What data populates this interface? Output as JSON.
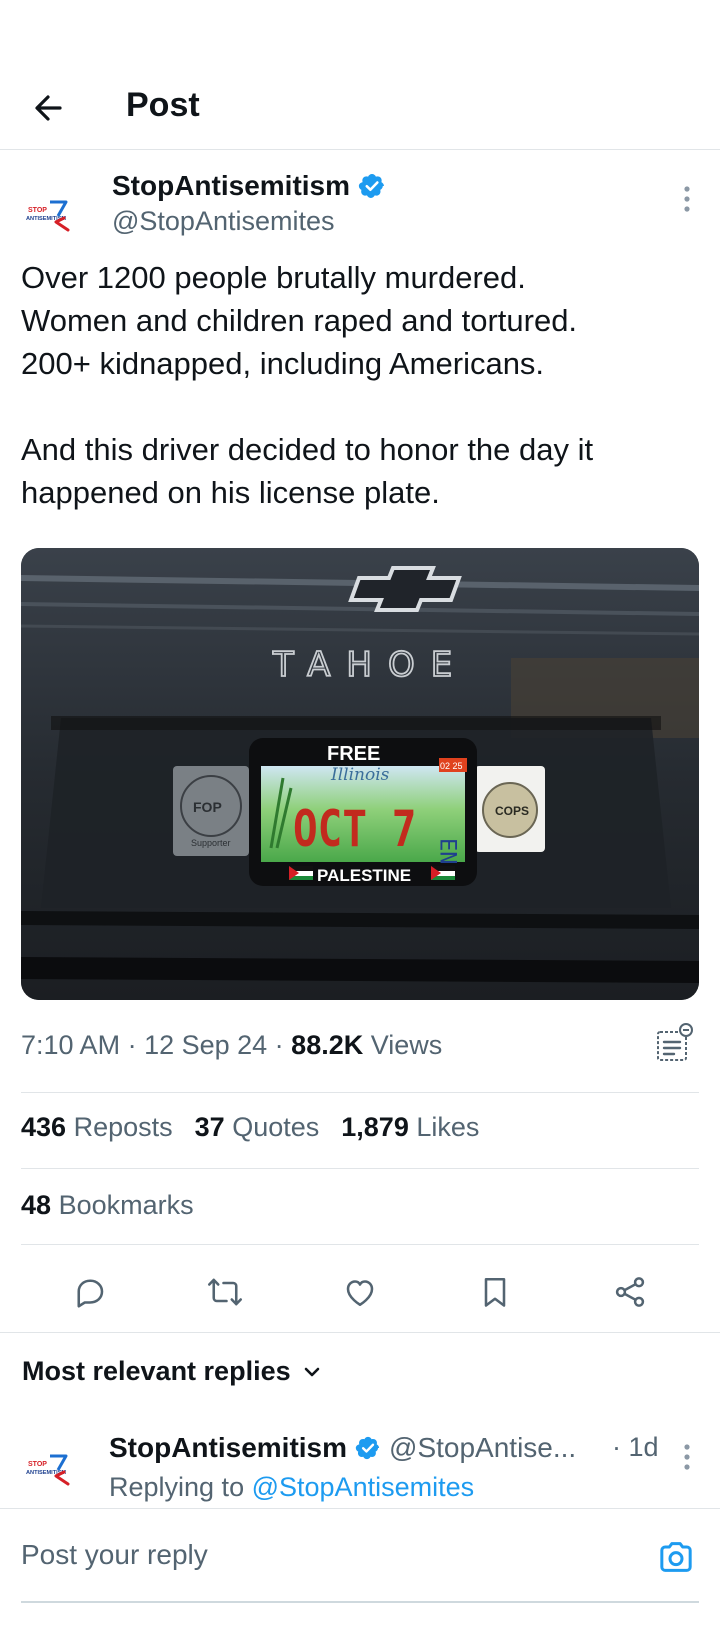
{
  "header": {
    "title": "Post"
  },
  "post": {
    "author_name": "StopAntisemitism",
    "author_handle": "@StopAntisemites",
    "avatar_logo_text": [
      "STOP",
      "ANTISEMITISM"
    ],
    "text": "Over 1200 people brutally murdered.\nWomen and children raped and tortured.\n200+ kidnapped, including Americans.\n\nAnd this driver decided to honor the day it happened on his license plate.",
    "image": {
      "car_badge": "TAHOE",
      "plate_frame_top": "FREE",
      "plate_state": "Illinois",
      "plate_number": "OCT 7",
      "plate_side": "EN",
      "plate_sticker": "02 25",
      "plate_frame_bottom": "PALESTINE",
      "left_sticker": "FOP",
      "left_sticker_sub": "Supporter",
      "right_sticker": "COPS"
    },
    "time": "7:10 AM",
    "date": "12 Sep 24",
    "views_count": "88.2K",
    "views_label": "Views",
    "reposts_count": "436",
    "reposts_label": "Reposts",
    "quotes_count": "37",
    "quotes_label": "Quotes",
    "likes_count": "1,879",
    "likes_label": "Likes",
    "bookmarks_count": "48",
    "bookmarks_label": "Bookmarks"
  },
  "replies": {
    "heading": "Most relevant replies",
    "items": [
      {
        "author_name": "StopAntisemitism",
        "author_handle": "@StopAntise...",
        "time": "· 1d",
        "replying_prefix": "Replying to",
        "replying_handle": "@StopAntisemites"
      }
    ]
  },
  "composer": {
    "placeholder": "Post your reply"
  },
  "colors": {
    "accent": "#1d9bf0",
    "text": "#0f1419",
    "muted": "#536471",
    "divider": "#e1e5e8"
  }
}
